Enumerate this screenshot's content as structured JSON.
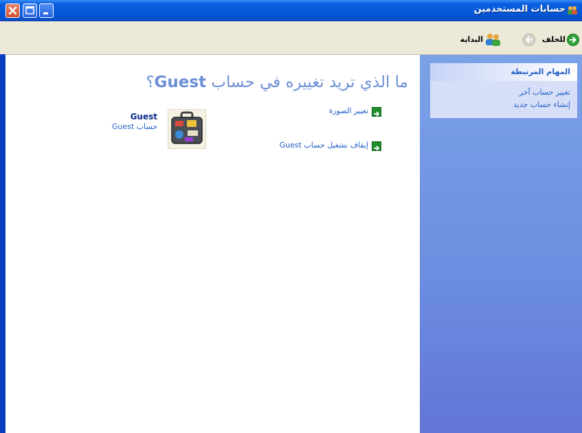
{
  "window": {
    "title": "حسابات المستخدمين"
  },
  "toolbar": {
    "back_label": "للخلف",
    "home_label": "البداية"
  },
  "taskpane": {
    "header": "المهام المرتبطة",
    "links": [
      "تغيير حساب آخر",
      "إنشاء حساب جديد"
    ]
  },
  "main": {
    "heading_prefix": "ما الذي تريد تغييره في حساب",
    "heading_account": "Guest",
    "heading_suffix": "؟",
    "tasks": [
      "تغيير الصورة",
      "إيقاف تشغيل حساب Guest"
    ]
  },
  "user": {
    "name": "Guest",
    "type": "حساب Guest"
  },
  "colors": {
    "titlebar": "#0558d8",
    "toolbar": "#ece9d8",
    "link": "#215dc6",
    "heading": "#6b8fd6",
    "taskpane": "#6b8de0"
  }
}
